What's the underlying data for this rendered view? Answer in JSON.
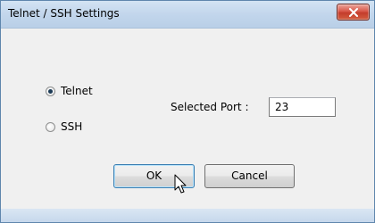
{
  "window": {
    "title": "Telnet / SSH Settings",
    "close_icon": "close-x-icon"
  },
  "protocol": {
    "options": [
      {
        "label": "Telnet",
        "checked": true
      },
      {
        "label": "SSH",
        "checked": false
      }
    ]
  },
  "port": {
    "label": "Selected Port :",
    "value": "23"
  },
  "buttons": {
    "ok_label": "OK",
    "cancel_label": "Cancel"
  },
  "colors": {
    "titlebar": "#c2d6ec",
    "client_background": "#f0f0f0",
    "close_button": "#c94030",
    "default_button_border": "#3c7fb1"
  },
  "cursor_icon": "mouse-pointer-icon"
}
